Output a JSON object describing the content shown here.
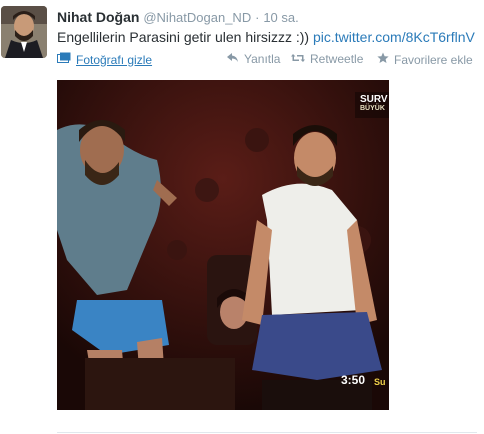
{
  "tweet": {
    "name": "Nihat Doğan",
    "handle": "@NihatDogan_ND",
    "separator": "·",
    "time": "10 sa.",
    "text": "Engellilerin Parasini getir ulen hirsizzz :))",
    "link": "pic.twitter.com/8KcT6rflnV"
  },
  "actions": {
    "hide_photo": "Fotoğrafı gizle",
    "reply": "Yanıtla",
    "retweet": "Retweetle",
    "favorite": "Favorilere ekle"
  },
  "photo_overlay": {
    "logo_line1": "SURV",
    "logo_line2": "BÜYÜK",
    "clock": "3:50",
    "corner": "Su"
  },
  "colors": {
    "link": "#2b7bb9",
    "muted": "#8899a6",
    "text": "#292f33"
  }
}
